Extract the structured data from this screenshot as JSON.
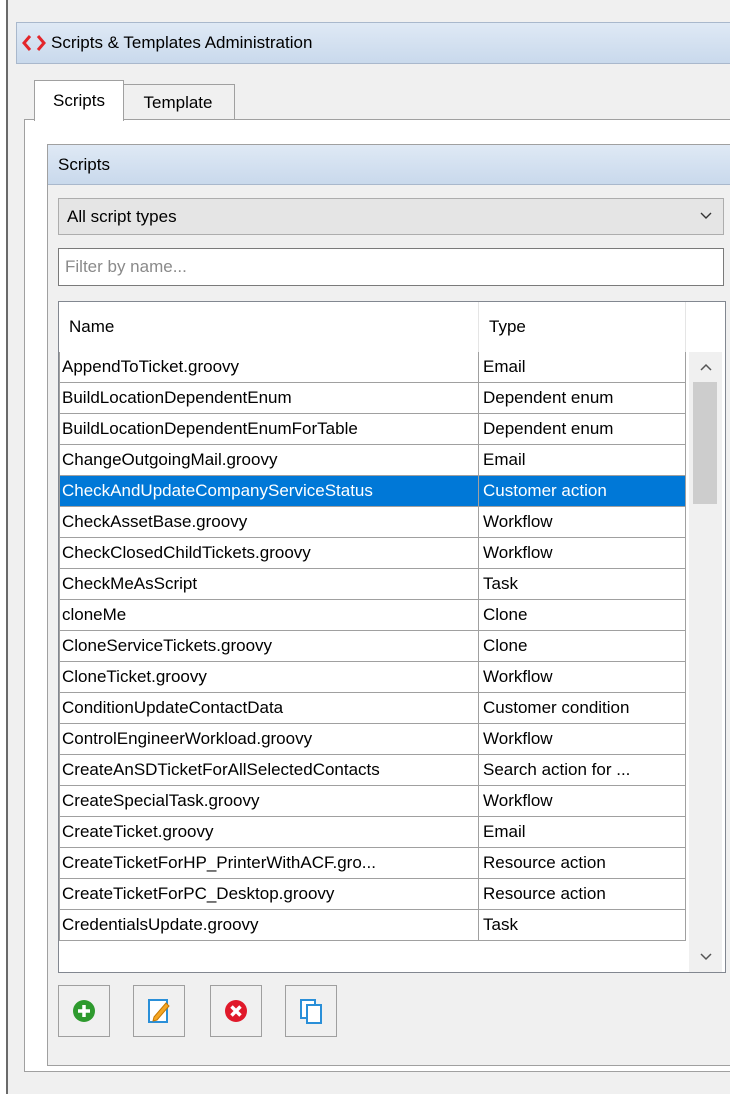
{
  "window": {
    "title": "Scripts & Templates Administration"
  },
  "tabs": [
    {
      "label": "Scripts"
    },
    {
      "label": "Template"
    }
  ],
  "group": {
    "title": "Scripts"
  },
  "type_filter": {
    "selected": "All script types"
  },
  "name_filter": {
    "placeholder": "Filter by name..."
  },
  "table": {
    "columns": [
      "Name",
      "Type"
    ],
    "rows": [
      {
        "name": "AppendToTicket.groovy",
        "type": "Email"
      },
      {
        "name": "BuildLocationDependentEnum",
        "type": "Dependent enum"
      },
      {
        "name": "BuildLocationDependentEnumForTable",
        "type": "Dependent enum"
      },
      {
        "name": "ChangeOutgoingMail.groovy",
        "type": "Email"
      },
      {
        "name": "CheckAndUpdateCompanyServiceStatus",
        "type": "Customer action",
        "selected": true
      },
      {
        "name": "CheckAssetBase.groovy",
        "type": "Workflow"
      },
      {
        "name": "CheckClosedChildTickets.groovy",
        "type": "Workflow"
      },
      {
        "name": "CheckMeAsScript",
        "type": "Task"
      },
      {
        "name": "cloneMe",
        "type": "Clone"
      },
      {
        "name": "CloneServiceTickets.groovy",
        "type": "Clone"
      },
      {
        "name": "CloneTicket.groovy",
        "type": "Workflow"
      },
      {
        "name": "ConditionUpdateContactData",
        "type": "Customer condition"
      },
      {
        "name": "ControlEngineerWorkload.groovy",
        "type": "Workflow"
      },
      {
        "name": "CreateAnSDTicketForAllSelectedContacts",
        "type": "Search action for ..."
      },
      {
        "name": "CreateSpecialTask.groovy",
        "type": "Workflow"
      },
      {
        "name": "CreateTicket.groovy",
        "type": "Email"
      },
      {
        "name": "CreateTicketForHP_PrinterWithACF.gro...",
        "type": "Resource action"
      },
      {
        "name": "CreateTicketForPC_Desktop.groovy",
        "type": "Resource action"
      },
      {
        "name": "CredentialsUpdate.groovy",
        "type": "Task"
      }
    ]
  },
  "toolbar": [
    "add-icon",
    "edit-icon",
    "delete-icon",
    "copy-icon"
  ],
  "colors": {
    "selection": "#0078d7",
    "header_gradient": "#c9d9ec",
    "brand_red": "#e3262b"
  }
}
